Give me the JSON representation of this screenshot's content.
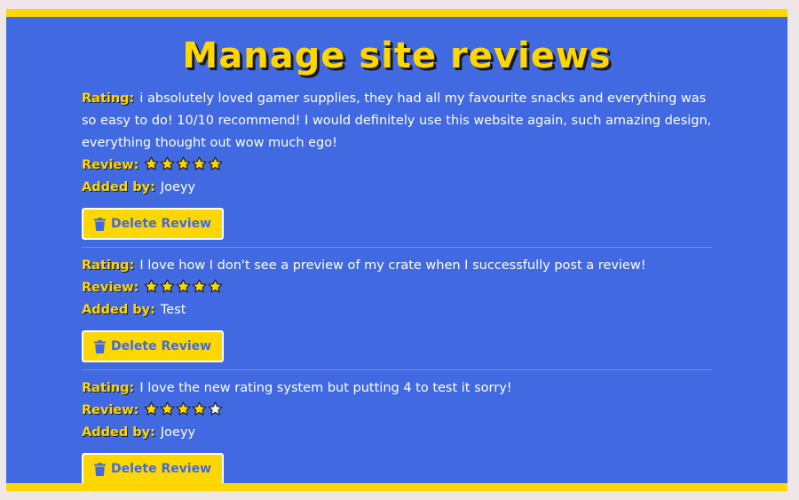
{
  "page": {
    "title": "Manage site reviews"
  },
  "labels": {
    "rating": "Rating:",
    "review": "Review:",
    "added_by": "Added by:",
    "delete": "Delete Review"
  },
  "colors": {
    "accent": "#ffd700",
    "panel": "#4169e1",
    "star_filled": "#ffd700",
    "star_empty": "#f0f0f0"
  },
  "icons": {
    "star": "star-icon",
    "delete": "trash-icon"
  },
  "reviews": [
    {
      "text": "i absolutely loved gamer supplies, they had all my favourite snacks and everything was so easy to do! 10/10 recommend! I would definitely use this website again, such amazing design, everything thought out wow much ego!",
      "stars": 5,
      "max_stars": 5,
      "author": "Joeyy"
    },
    {
      "text": "I love how I don't see a preview of my crate when I successfully post a review!",
      "stars": 5,
      "max_stars": 5,
      "author": "Test"
    },
    {
      "text": "I love the new rating system but putting 4 to test it sorry!",
      "stars": 4,
      "max_stars": 5,
      "author": "Joeyy"
    }
  ]
}
